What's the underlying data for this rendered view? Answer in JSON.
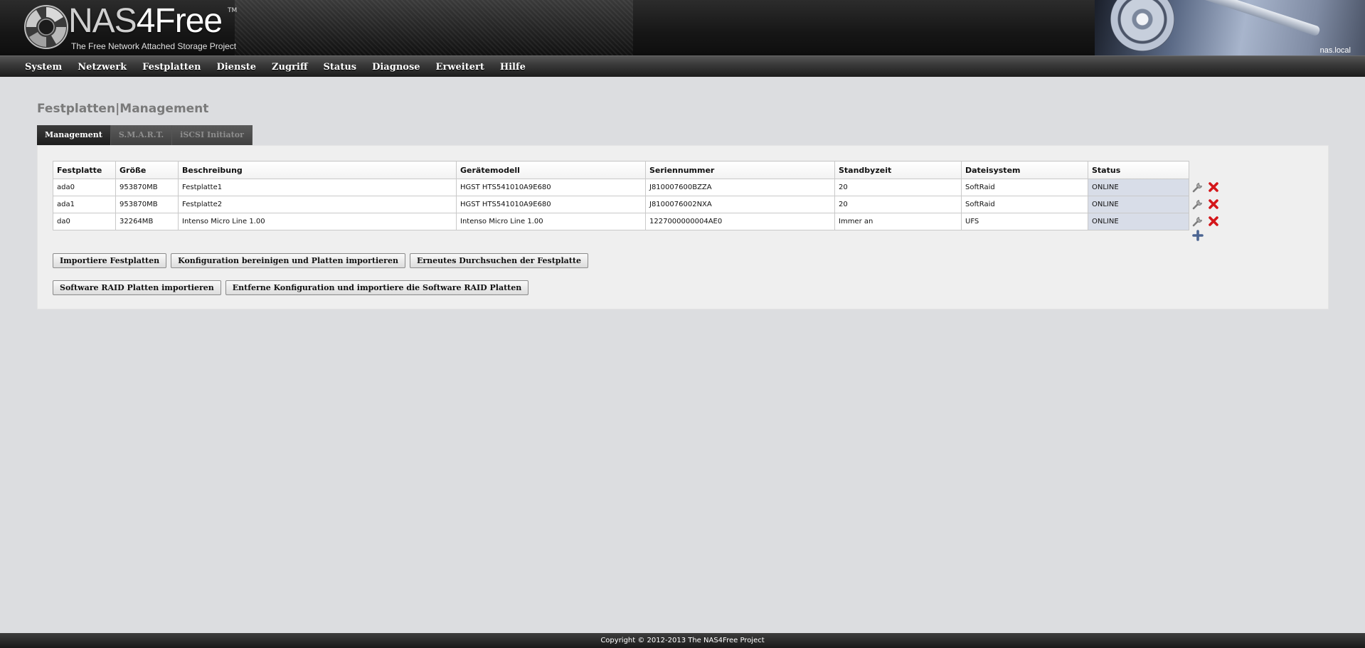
{
  "header": {
    "logo_part_a": "NAS",
    "logo_part_b": "4Free",
    "logo_tm": "TM",
    "tagline": "The Free Network Attached Storage Project",
    "hostname": "nas.local"
  },
  "nav": {
    "items": [
      {
        "label": "System"
      },
      {
        "label": "Netzwerk"
      },
      {
        "label": "Festplatten"
      },
      {
        "label": "Dienste"
      },
      {
        "label": "Zugriff"
      },
      {
        "label": "Status"
      },
      {
        "label": "Diagnose"
      },
      {
        "label": "Erweitert"
      },
      {
        "label": "Hilfe"
      }
    ]
  },
  "page": {
    "title_section": "Festplatten",
    "title_separator": "|",
    "title_page": "Management"
  },
  "tabs": [
    {
      "label": "Management",
      "active": true
    },
    {
      "label": "S.M.A.R.T.",
      "active": false
    },
    {
      "label": "iSCSI Initiator",
      "active": false
    }
  ],
  "table": {
    "columns": [
      "Festplatte",
      "Größe",
      "Beschreibung",
      "Gerätemodell",
      "Seriennummer",
      "Standbyzeit",
      "Dateisystem",
      "Status"
    ],
    "rows": [
      [
        "ada0",
        "953870MB",
        "Festplatte1",
        "HGST HTS541010A9E680",
        "J810007600BZZA",
        "20",
        "SoftRaid",
        "ONLINE"
      ],
      [
        "ada1",
        "953870MB",
        "Festplatte2",
        "HGST HTS541010A9E680",
        "J8100076002NXA",
        "20",
        "SoftRaid",
        "ONLINE"
      ],
      [
        "da0",
        "32264MB",
        "Intenso Micro Line 1.00",
        "Intenso Micro Line 1.00",
        "1227000000004AE0",
        "Immer an",
        "UFS",
        "ONLINE"
      ]
    ]
  },
  "buttons": {
    "row1": [
      {
        "label": "Importiere Festplatten"
      },
      {
        "label": "Konfiguration bereinigen und Platten importieren"
      },
      {
        "label": "Erneutes Durchsuchen der Festplatte"
      }
    ],
    "row2": [
      {
        "label": "Software RAID Platten importieren"
      },
      {
        "label": "Entferne Konfiguration und importiere die Software RAID Platten"
      }
    ]
  },
  "icons": {
    "edit": "wrench-icon",
    "delete": "delete-x-icon",
    "add": "plus-icon"
  },
  "colors": {
    "delete": "#d4161a",
    "add": "#4b6592",
    "status_bg": "#d8dde8"
  },
  "footer": {
    "copyright": "Copyright © 2012-2013 The NAS4Free Project"
  }
}
